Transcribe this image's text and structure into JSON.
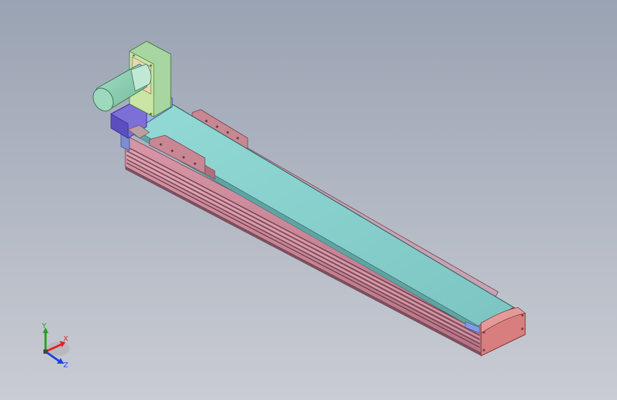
{
  "app": {
    "kind": "3D CAD model viewport"
  },
  "viewport": {
    "background_top": "#9aa3b3",
    "background_bottom": "#c9ccd3",
    "model_name": ""
  },
  "colors": {
    "carriage_top": "#8dd3d0",
    "carriage_side": "#6fb7b5",
    "rail_body": "#cf8e9e",
    "rail_dark": "#7b5160",
    "end_cap": "#d87e7e",
    "motor_body": "#8fd0b5",
    "motor_flange": "#a7d6a0",
    "coupler_block": "#7c6fd8",
    "plate_blue": "#9bb0e6"
  },
  "triad": {
    "x_label": "X",
    "y_label": "Y",
    "z_label": "Z",
    "x_color": "#e02424",
    "y_color": "#24a024",
    "z_color": "#2440e0"
  }
}
